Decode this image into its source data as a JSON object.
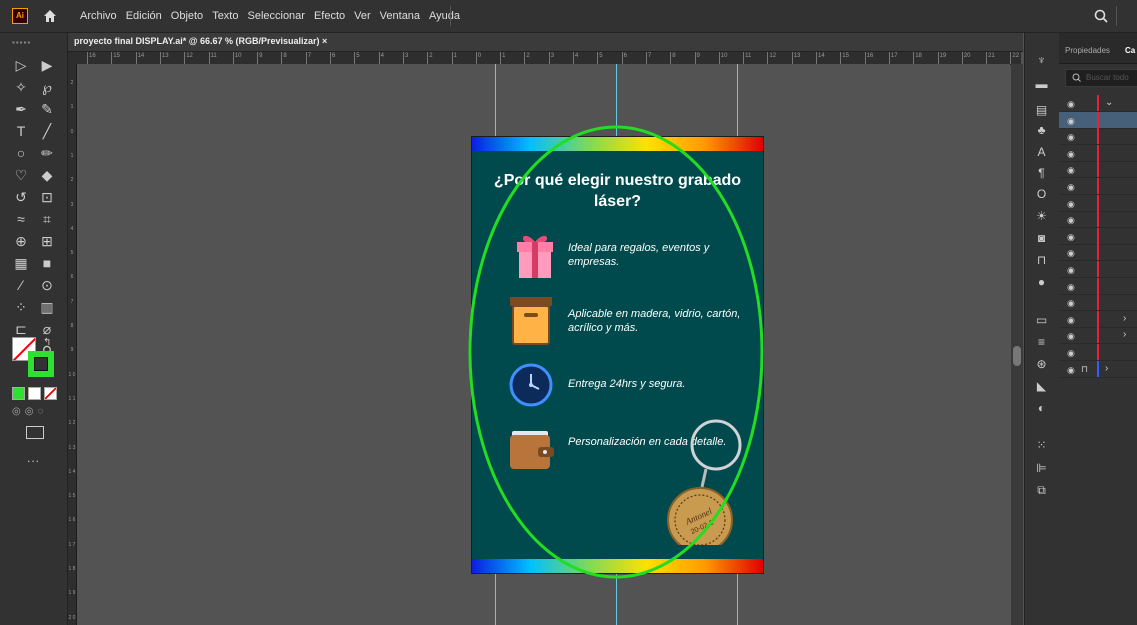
{
  "app": {
    "logo_text": "Ai",
    "menu": [
      "Archivo",
      "Edición",
      "Objeto",
      "Texto",
      "Seleccionar",
      "Efecto",
      "Ver",
      "Ventana",
      "Ayuda"
    ]
  },
  "document": {
    "tab_title": "proyecto final DISPLAY.ai* @ 66.67 % (RGB/Previsualizar)",
    "close_glyph": "×"
  },
  "ruler": {
    "top_labels": [
      "16",
      "15",
      "14",
      "13",
      "12",
      "11",
      "10",
      "9",
      "8",
      "7",
      "6",
      "5",
      "4",
      "3",
      "2",
      "1",
      "0",
      "1",
      "2",
      "3",
      "4",
      "5",
      "6",
      "7",
      "8",
      "9",
      "10",
      "11",
      "12",
      "13",
      "14",
      "15",
      "16",
      "17",
      "18",
      "19",
      "20",
      "21",
      "22"
    ],
    "left_labels": [
      "2",
      "1",
      "0",
      "1",
      "2",
      "3",
      "4",
      "5",
      "6",
      "7",
      "8",
      "9",
      "1 0",
      "1 1",
      "1 2",
      "1 3",
      "1 4",
      "1 5",
      "1 6",
      "1 7",
      "1 8",
      "1 9",
      "2 0"
    ]
  },
  "artboard": {
    "headline": "¿Por qué elegir nuestro grabado láser?",
    "features": [
      {
        "icon": "gift-icon",
        "text": "Ideal para regalos, eventos y empresas."
      },
      {
        "icon": "box-icon",
        "text": "Aplicable en madera, vidrio, cartón, acrílico y más."
      },
      {
        "icon": "clock-icon",
        "text": "Entrega 24hrs y segura."
      },
      {
        "icon": "wallet-icon",
        "text": "Personalización en cada detalle."
      }
    ],
    "keychain_text": [
      "Antonel",
      "20-02-2"
    ],
    "colors": {
      "background": "#004a4d",
      "ellipse_stroke": "#22dd22"
    }
  },
  "tools": {
    "fill_color": "none",
    "stroke_color": "#30e030",
    "more_label": "..."
  },
  "right_panel": {
    "tabs": [
      "Propiedades",
      "Ca"
    ],
    "search_placeholder": "Buscar todo",
    "layer_rows": 17
  }
}
